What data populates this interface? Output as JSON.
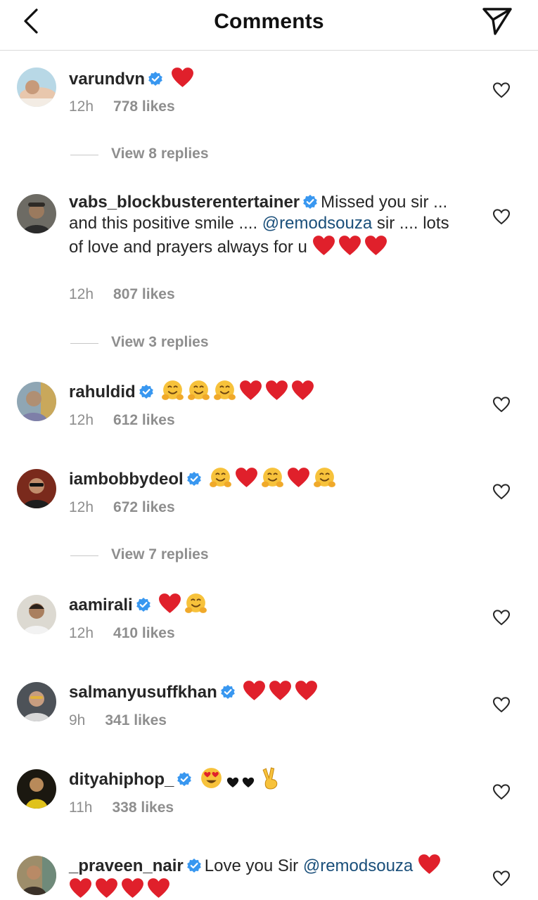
{
  "header": {
    "title": "Comments",
    "back_icon": "chevron-left-icon",
    "send_icon": "paper-plane-icon"
  },
  "comments": [
    {
      "username": "varundvn",
      "verified": true,
      "text": "",
      "mention": "",
      "text_after": "",
      "emojis": [
        "red-heart"
      ],
      "time": "12h",
      "likes": "778 likes",
      "replies": "View 8 replies",
      "avatar_bg": "#c9b8a6"
    },
    {
      "username": "vabs_blockbusterentertainer",
      "verified": true,
      "text": "Missed you sir ... and this positive smile .... ",
      "mention": "@remodsouza",
      "text_after": " sir .... lots of love and prayers always for u",
      "emojis": [
        "red-heart",
        "red-heart",
        "red-heart"
      ],
      "time": "12h",
      "likes": "807 likes",
      "replies": "View 3 replies",
      "avatar_bg": "#4a4a48"
    },
    {
      "username": "rahuldid",
      "verified": true,
      "text": "",
      "mention": "",
      "text_after": "",
      "emojis": [
        "hugging-face",
        "hugging-face",
        "hugging-face",
        "red-heart",
        "red-heart",
        "red-heart"
      ],
      "time": "12h",
      "likes": "612 likes",
      "replies": "",
      "avatar_bg": "#7a8f9c"
    },
    {
      "username": "iambobbydeol",
      "verified": true,
      "text": "",
      "mention": "",
      "text_after": "",
      "emojis": [
        "hugging-face",
        "red-heart",
        "hugging-face",
        "red-heart",
        "hugging-face"
      ],
      "time": "12h",
      "likes": "672 likes",
      "replies": "View 7 replies",
      "avatar_bg": "#6b2a1e"
    },
    {
      "username": "aamirali",
      "verified": true,
      "text": "",
      "mention": "",
      "text_after": "",
      "emojis": [
        "red-heart",
        "hugging-face"
      ],
      "time": "12h",
      "likes": "410 likes",
      "replies": "",
      "avatar_bg": "#d9d6cf"
    },
    {
      "username": "salmanyusuffkhan",
      "verified": true,
      "text": "",
      "mention": "",
      "text_after": "",
      "emojis": [
        "red-heart",
        "red-heart",
        "red-heart"
      ],
      "time": "9h",
      "likes": "341 likes",
      "replies": "",
      "avatar_bg": "#555a60"
    },
    {
      "username": "dityahiphop_",
      "verified": true,
      "text": "",
      "mention": "",
      "text_after": "",
      "emojis": [
        "heart-eyes",
        "black-heart",
        "black-heart",
        "victory-hand"
      ],
      "time": "11h",
      "likes": "338 likes",
      "replies": "",
      "avatar_bg": "#1e1b12"
    },
    {
      "username": "_praveen_nair",
      "verified": true,
      "text": "Love you Sir ",
      "mention": "@remodsouza",
      "text_after": "",
      "emojis": [
        "red-heart",
        "red-heart",
        "red-heart",
        "red-heart",
        "red-heart"
      ],
      "time": "",
      "likes": "",
      "replies": "",
      "avatar_bg": "#8a7a5c"
    }
  ],
  "colors": {
    "accent": "#0095f6",
    "verified": "#3897f0",
    "heart": "#e0202b",
    "mention": "#1a4f7a",
    "muted": "#8e8e8e"
  }
}
